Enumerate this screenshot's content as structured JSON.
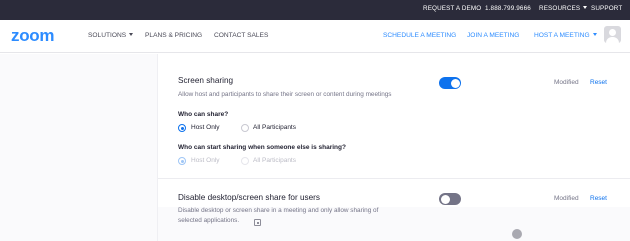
{
  "topbar": {
    "request_demo": "REQUEST A DEMO",
    "phone": "1.888.799.9666",
    "resources": "RESOURCES",
    "support": "SUPPORT"
  },
  "nav": {
    "logo": "zoom",
    "solutions": "SOLUTIONS",
    "plans": "PLANS & PRICING",
    "contact": "CONTACT SALES",
    "schedule": "SCHEDULE A MEETING",
    "join": "JOIN A MEETING",
    "host": "HOST A MEETING"
  },
  "settings": [
    {
      "title": "Screen sharing",
      "description": "Allow host and participants to share their screen or content during meetings",
      "enabled": true,
      "modified_label": "Modified",
      "reset_label": "Reset",
      "who_can_share": {
        "label": "Who can share?",
        "options": [
          "Host Only",
          "All Participants"
        ],
        "selected": "Host Only"
      },
      "who_can_start": {
        "label": "Who can start sharing when someone else is sharing?",
        "options": [
          "Host Only",
          "All Participants"
        ],
        "selected": "Host Only"
      }
    },
    {
      "title": "Disable desktop/screen share for users",
      "description_line1": "Disable desktop or screen share in a meeting and only allow sharing of",
      "description_line2": "selected applications.",
      "enabled": false,
      "modified_label": "Modified",
      "reset_label": "Reset"
    }
  ],
  "colors": {
    "brand_blue": "#2d8cff",
    "toggle_on": "#0e72ed",
    "toggle_off": "#747487",
    "topbar": "#2b2b3a"
  }
}
